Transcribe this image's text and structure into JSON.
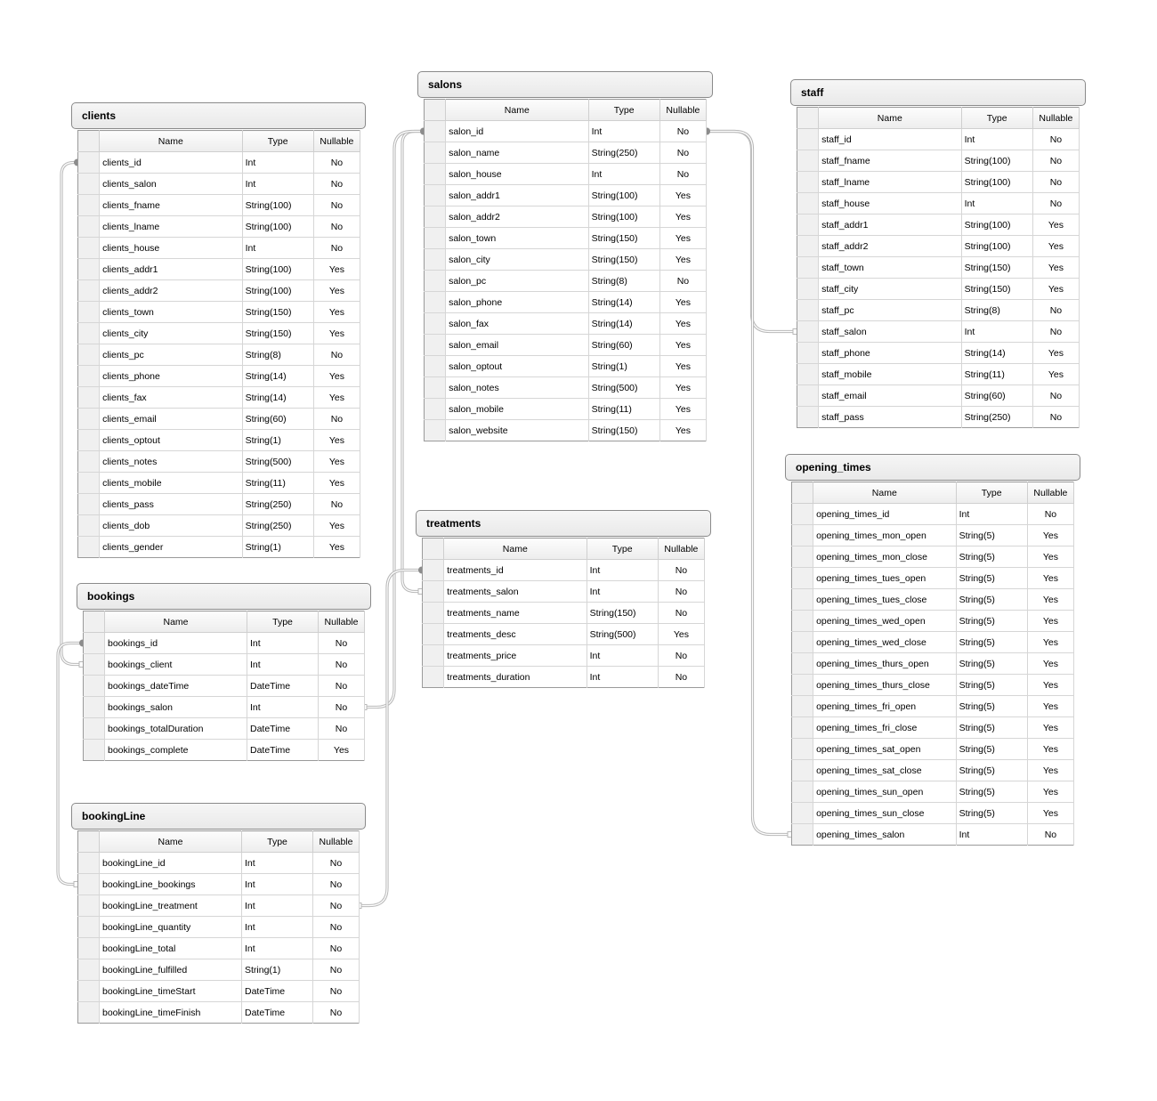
{
  "columns": {
    "name": "Name",
    "type": "Type",
    "nullable": "Nullable"
  },
  "colors": {
    "connector": "#b8b8b8",
    "connector_end": "#8c8c8c",
    "border": "#9a9a9a",
    "title_bg": "#ececec"
  },
  "tables": {
    "clients": {
      "title": "clients",
      "rows": [
        {
          "name": "clients_id",
          "type": "Int",
          "nullable": "No"
        },
        {
          "name": "clients_salon",
          "type": "Int",
          "nullable": "No"
        },
        {
          "name": "clients_fname",
          "type": "String(100)",
          "nullable": "No"
        },
        {
          "name": "clients_lname",
          "type": "String(100)",
          "nullable": "No"
        },
        {
          "name": "clients_house",
          "type": "Int",
          "nullable": "No"
        },
        {
          "name": "clients_addr1",
          "type": "String(100)",
          "nullable": "Yes"
        },
        {
          "name": "clients_addr2",
          "type": "String(100)",
          "nullable": "Yes"
        },
        {
          "name": "clients_town",
          "type": "String(150)",
          "nullable": "Yes"
        },
        {
          "name": "clients_city",
          "type": "String(150)",
          "nullable": "Yes"
        },
        {
          "name": "clients_pc",
          "type": "String(8)",
          "nullable": "No"
        },
        {
          "name": "clients_phone",
          "type": "String(14)",
          "nullable": "Yes"
        },
        {
          "name": "clients_fax",
          "type": "String(14)",
          "nullable": "Yes"
        },
        {
          "name": "clients_email",
          "type": "String(60)",
          "nullable": "No"
        },
        {
          "name": "clients_optout",
          "type": "String(1)",
          "nullable": "Yes"
        },
        {
          "name": "clients_notes",
          "type": "String(500)",
          "nullable": "Yes"
        },
        {
          "name": "clients_mobile",
          "type": "String(11)",
          "nullable": "Yes"
        },
        {
          "name": "clients_pass",
          "type": "String(250)",
          "nullable": "No"
        },
        {
          "name": "clients_dob",
          "type": "String(250)",
          "nullable": "Yes"
        },
        {
          "name": "clients_gender",
          "type": "String(1)",
          "nullable": "Yes"
        }
      ]
    },
    "salons": {
      "title": "salons",
      "rows": [
        {
          "name": "salon_id",
          "type": "Int",
          "nullable": "No"
        },
        {
          "name": "salon_name",
          "type": "String(250)",
          "nullable": "No"
        },
        {
          "name": "salon_house",
          "type": "Int",
          "nullable": "No"
        },
        {
          "name": "salon_addr1",
          "type": "String(100)",
          "nullable": "Yes"
        },
        {
          "name": "salon_addr2",
          "type": "String(100)",
          "nullable": "Yes"
        },
        {
          "name": "salon_town",
          "type": "String(150)",
          "nullable": "Yes"
        },
        {
          "name": "salon_city",
          "type": "String(150)",
          "nullable": "Yes"
        },
        {
          "name": "salon_pc",
          "type": "String(8)",
          "nullable": "No"
        },
        {
          "name": "salon_phone",
          "type": "String(14)",
          "nullable": "Yes"
        },
        {
          "name": "salon_fax",
          "type": "String(14)",
          "nullable": "Yes"
        },
        {
          "name": "salon_email",
          "type": "String(60)",
          "nullable": "Yes"
        },
        {
          "name": "salon_optout",
          "type": "String(1)",
          "nullable": "Yes"
        },
        {
          "name": "salon_notes",
          "type": "String(500)",
          "nullable": "Yes"
        },
        {
          "name": "salon_mobile",
          "type": "String(11)",
          "nullable": "Yes"
        },
        {
          "name": "salon_website",
          "type": "String(150)",
          "nullable": "Yes"
        }
      ]
    },
    "staff": {
      "title": "staff",
      "rows": [
        {
          "name": "staff_id",
          "type": "Int",
          "nullable": "No"
        },
        {
          "name": "staff_fname",
          "type": "String(100)",
          "nullable": "No"
        },
        {
          "name": "staff_lname",
          "type": "String(100)",
          "nullable": "No"
        },
        {
          "name": "staff_house",
          "type": "Int",
          "nullable": "No"
        },
        {
          "name": "staff_addr1",
          "type": "String(100)",
          "nullable": "Yes"
        },
        {
          "name": "staff_addr2",
          "type": "String(100)",
          "nullable": "Yes"
        },
        {
          "name": "staff_town",
          "type": "String(150)",
          "nullable": "Yes"
        },
        {
          "name": "staff_city",
          "type": "String(150)",
          "nullable": "Yes"
        },
        {
          "name": "staff_pc",
          "type": "String(8)",
          "nullable": "No"
        },
        {
          "name": "staff_salon",
          "type": "Int",
          "nullable": "No"
        },
        {
          "name": "staff_phone",
          "type": "String(14)",
          "nullable": "Yes"
        },
        {
          "name": "staff_mobile",
          "type": "String(11)",
          "nullable": "Yes"
        },
        {
          "name": "staff_email",
          "type": "String(60)",
          "nullable": "No"
        },
        {
          "name": "staff_pass",
          "type": "String(250)",
          "nullable": "No"
        }
      ]
    },
    "treatments": {
      "title": "treatments",
      "rows": [
        {
          "name": "treatments_id",
          "type": "Int",
          "nullable": "No"
        },
        {
          "name": "treatments_salon",
          "type": "Int",
          "nullable": "No"
        },
        {
          "name": "treatments_name",
          "type": "String(150)",
          "nullable": "No"
        },
        {
          "name": "treatments_desc",
          "type": "String(500)",
          "nullable": "Yes"
        },
        {
          "name": "treatments_price",
          "type": "Int",
          "nullable": "No"
        },
        {
          "name": "treatments_duration",
          "type": "Int",
          "nullable": "No"
        }
      ]
    },
    "opening_times": {
      "title": "opening_times",
      "rows": [
        {
          "name": "opening_times_id",
          "type": "Int",
          "nullable": "No"
        },
        {
          "name": "opening_times_mon_open",
          "type": "String(5)",
          "nullable": "Yes"
        },
        {
          "name": "opening_times_mon_close",
          "type": "String(5)",
          "nullable": "Yes"
        },
        {
          "name": "opening_times_tues_open",
          "type": "String(5)",
          "nullable": "Yes"
        },
        {
          "name": "opening_times_tues_close",
          "type": "String(5)",
          "nullable": "Yes"
        },
        {
          "name": "opening_times_wed_open",
          "type": "String(5)",
          "nullable": "Yes"
        },
        {
          "name": "opening_times_wed_close",
          "type": "String(5)",
          "nullable": "Yes"
        },
        {
          "name": "opening_times_thurs_open",
          "type": "String(5)",
          "nullable": "Yes"
        },
        {
          "name": "opening_times_thurs_close",
          "type": "String(5)",
          "nullable": "Yes"
        },
        {
          "name": "opening_times_fri_open",
          "type": "String(5)",
          "nullable": "Yes"
        },
        {
          "name": "opening_times_fri_close",
          "type": "String(5)",
          "nullable": "Yes"
        },
        {
          "name": "opening_times_sat_open",
          "type": "String(5)",
          "nullable": "Yes"
        },
        {
          "name": "opening_times_sat_close",
          "type": "String(5)",
          "nullable": "Yes"
        },
        {
          "name": "opening_times_sun_open",
          "type": "String(5)",
          "nullable": "Yes"
        },
        {
          "name": "opening_times_sun_close",
          "type": "String(5)",
          "nullable": "Yes"
        },
        {
          "name": "opening_times_salon",
          "type": "Int",
          "nullable": "No"
        }
      ]
    },
    "bookings": {
      "title": "bookings",
      "rows": [
        {
          "name": "bookings_id",
          "type": "Int",
          "nullable": "No"
        },
        {
          "name": "bookings_client",
          "type": "Int",
          "nullable": "No"
        },
        {
          "name": "bookings_dateTime",
          "type": "DateTime",
          "nullable": "No"
        },
        {
          "name": "bookings_salon",
          "type": "Int",
          "nullable": "No"
        },
        {
          "name": "bookings_totalDuration",
          "type": "DateTime",
          "nullable": "No"
        },
        {
          "name": "bookings_complete",
          "type": "DateTime",
          "nullable": "Yes"
        }
      ]
    },
    "bookingLine": {
      "title": "bookingLine",
      "rows": [
        {
          "name": "bookingLine_id",
          "type": "Int",
          "nullable": "No"
        },
        {
          "name": "bookingLine_bookings",
          "type": "Int",
          "nullable": "No"
        },
        {
          "name": "bookingLine_treatment",
          "type": "Int",
          "nullable": "No"
        },
        {
          "name": "bookingLine_quantity",
          "type": "Int",
          "nullable": "No"
        },
        {
          "name": "bookingLine_total",
          "type": "Int",
          "nullable": "No"
        },
        {
          "name": "bookingLine_fulfilled",
          "type": "String(1)",
          "nullable": "No"
        },
        {
          "name": "bookingLine_timeStart",
          "type": "DateTime",
          "nullable": "No"
        },
        {
          "name": "bookingLine_timeFinish",
          "type": "DateTime",
          "nullable": "No"
        }
      ]
    }
  },
  "relationships": [
    {
      "from_table": "clients",
      "from_field": "clients_id",
      "to_table": "bookings",
      "to_field": "bookings_client"
    },
    {
      "from_table": "salons",
      "from_field": "salon_id",
      "to_table": "staff",
      "to_field": "staff_salon"
    },
    {
      "from_table": "salons",
      "from_field": "salon_id",
      "to_table": "opening_times",
      "to_field": "opening_times_salon"
    },
    {
      "from_table": "salons",
      "from_field": "salon_id",
      "to_table": "treatments",
      "to_field": "treatments_salon"
    },
    {
      "from_table": "salons",
      "from_field": "salon_id",
      "to_table": "bookings",
      "to_field": "bookings_salon"
    },
    {
      "from_table": "bookings",
      "from_field": "bookings_id",
      "to_table": "bookingLine",
      "to_field": "bookingLine_bookings"
    },
    {
      "from_table": "treatments",
      "from_field": "treatments_id",
      "to_table": "bookingLine",
      "to_field": "bookingLine_treatment"
    }
  ]
}
